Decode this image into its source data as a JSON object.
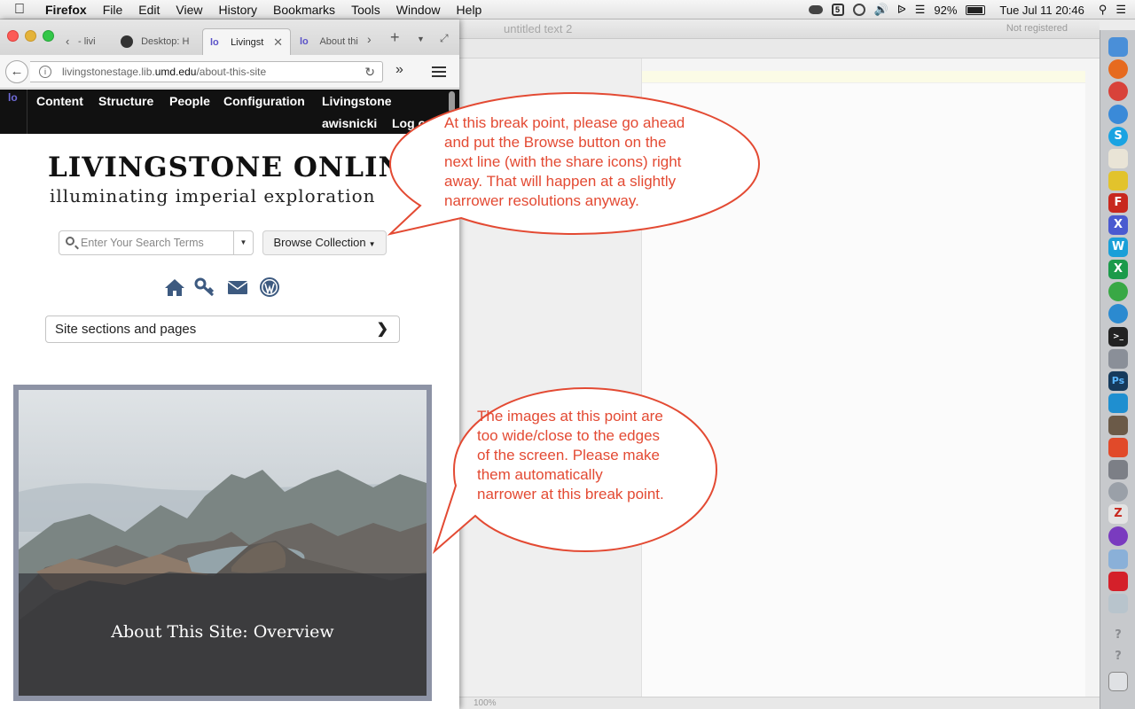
{
  "menubar": {
    "apple": "",
    "app": "Firefox",
    "items": [
      "File",
      "Edit",
      "View",
      "History",
      "Bookmarks",
      "Tools",
      "Window",
      "Help"
    ],
    "battery": "92%",
    "datetime": "Tue Jul 11  20:46"
  },
  "editor": {
    "doc_title": "untitled text 2",
    "registration": "Not registered",
    "zoom": "100%"
  },
  "browser": {
    "tabs": [
      {
        "label": "- livi"
      },
      {
        "label": "Desktop: H"
      },
      {
        "label": "Livingst"
      },
      {
        "label": "About thi"
      }
    ],
    "new_tab": "+",
    "url_host": "livingstonestage.lib.umd.edu",
    "url_path": "/about-this-site"
  },
  "admin": {
    "logo": "lo",
    "items": [
      "Content",
      "Structure",
      "People",
      "Configuration",
      "Livingstone"
    ],
    "user": "awisnicki",
    "logout": "Log o"
  },
  "site": {
    "title": "LIVINGSTONE ONLINE",
    "subtitle": "illuminating imperial exploration",
    "search_placeholder": "Enter Your Search Terms",
    "browse_label": "Browse Collection",
    "sections_label": "Site sections and pages",
    "feature_caption": "About This Site: Overview"
  },
  "annotations": {
    "callout_1": [
      "At this break point, please go ahead",
      "and put the Browse button on the",
      "next line (with the share icons) right",
      "away. That will happen at a slightly",
      "narrower resolutions anyway."
    ],
    "callout_2": [
      "The images at this point are",
      "too wide/close to the edges",
      "of the screen. Please make",
      "them automatically",
      "narrower at this break point."
    ],
    "color": "#e34a33"
  },
  "colors": {
    "admin_bg": "#111111",
    "share_icon": "#3d5a80",
    "frame": "#8d93a5"
  }
}
